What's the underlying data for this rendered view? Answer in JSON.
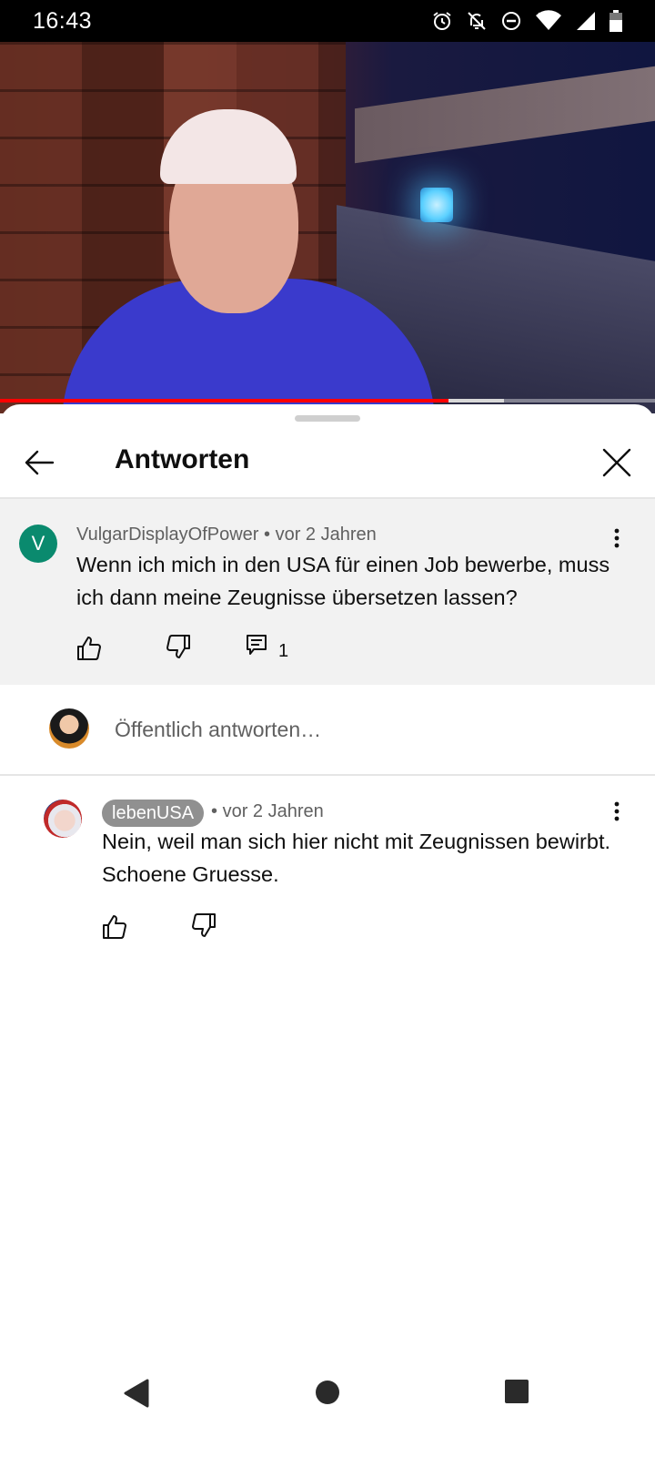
{
  "status_bar": {
    "time": "16:43",
    "icons": [
      "alarm-icon",
      "bell-off-icon",
      "do-not-disturb-icon",
      "wifi-icon",
      "signal-icon",
      "battery-icon"
    ]
  },
  "video": {
    "progress_fraction": 0.685,
    "buffered_fraction": 0.77
  },
  "sheet": {
    "title": "Antworten"
  },
  "parent_comment": {
    "author": "VulgarDisplayOfPower",
    "separator": "•",
    "time": "vor 2 Jahren",
    "avatar_letter": "V",
    "avatar_color": "#0a8a6e",
    "text": "Wenn ich mich in den USA für einen Job bewerbe, muss ich dann meine Zeugnisse übersetzen lassen?",
    "reply_count": "1"
  },
  "reply_input": {
    "placeholder": "Öffentlich antworten…"
  },
  "replies": [
    {
      "author": "lebenUSA",
      "separator": "•",
      "time": "vor 2 Jahren",
      "text": "Nein, weil man sich hier nicht mit Zeugnissen bewirbt. Schoene Gruesse."
    }
  ],
  "colors": {
    "accent_red": "#ff0000",
    "author_chip": "#909090",
    "parent_bg": "#f2f2f2"
  }
}
